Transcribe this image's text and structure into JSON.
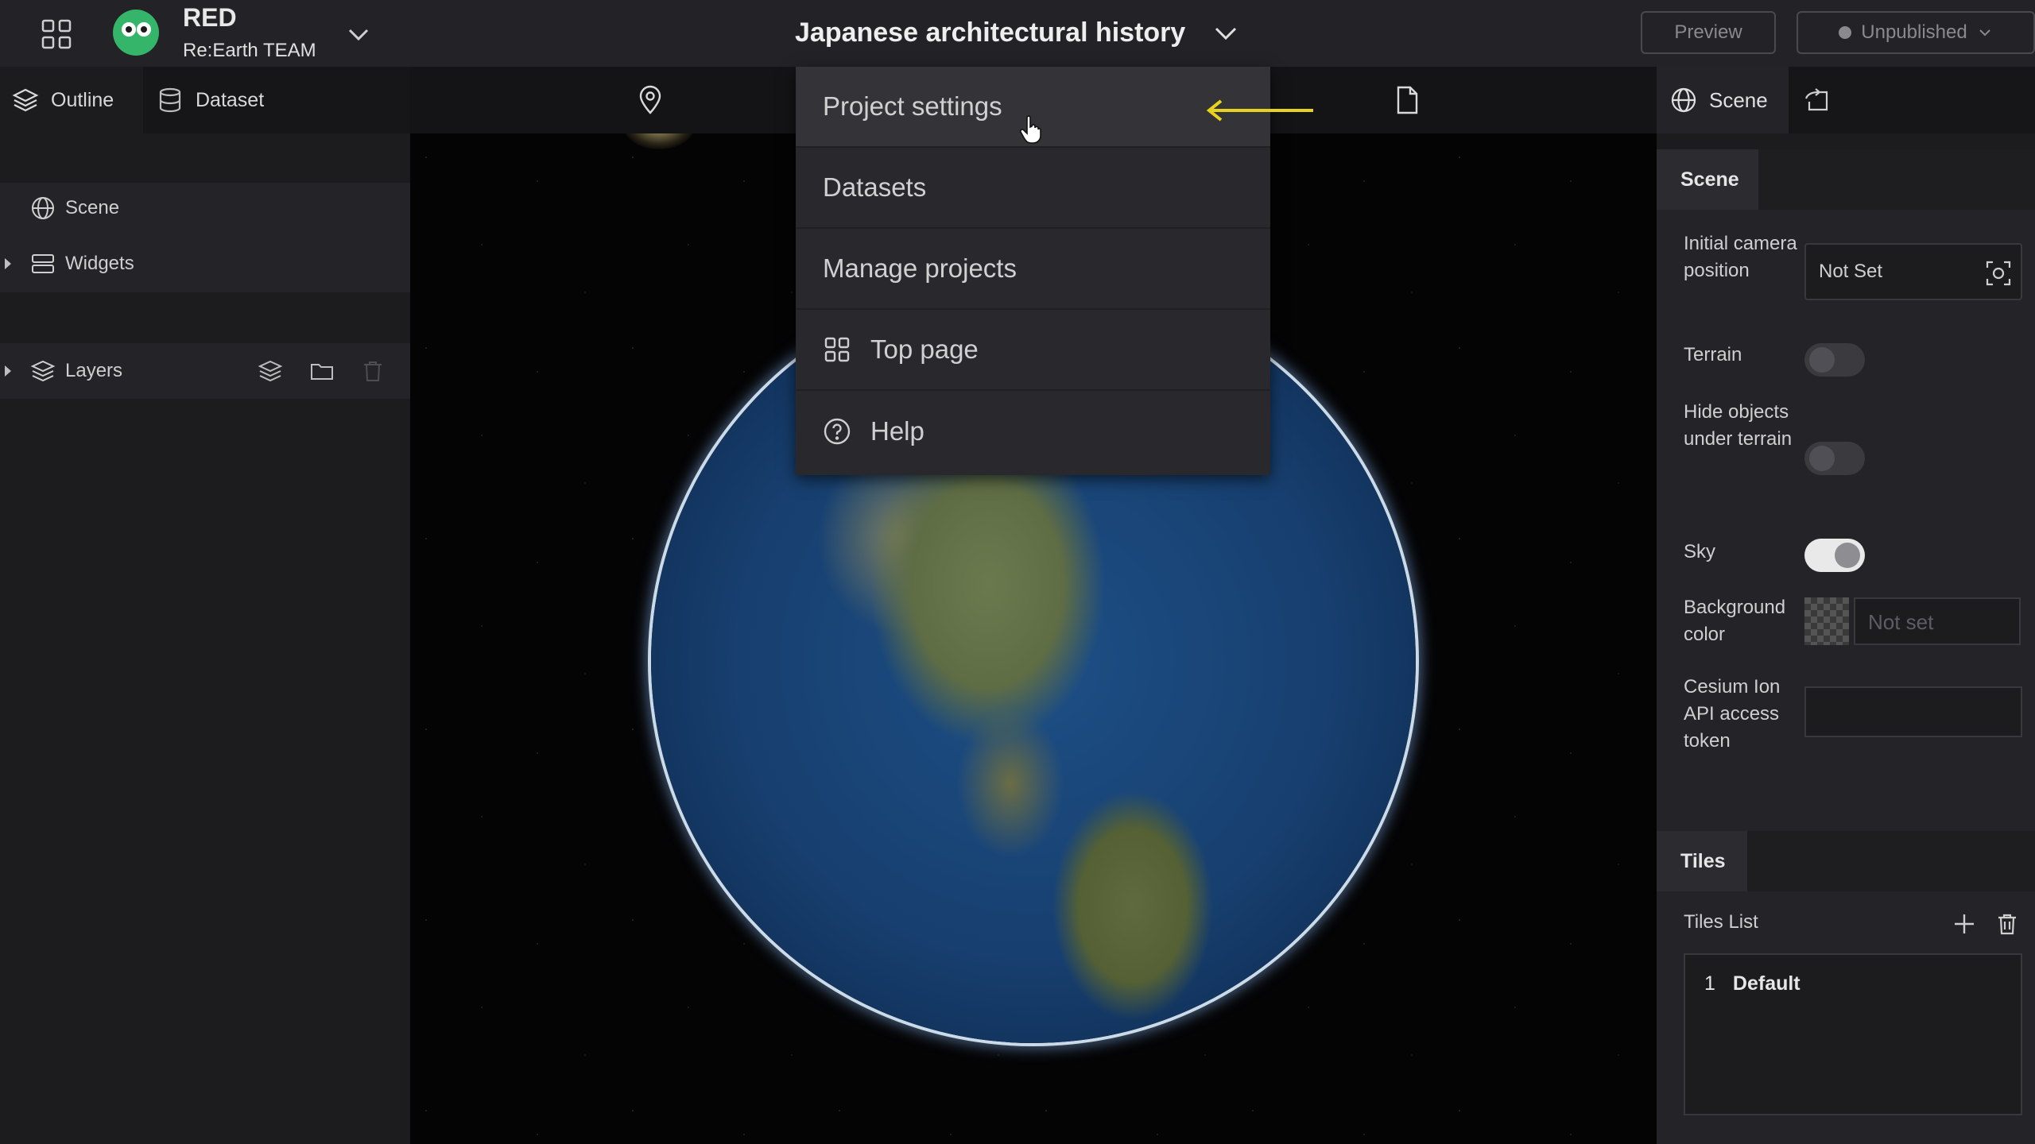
{
  "header": {
    "workspace_name": "RED",
    "workspace_team": "Re:Earth TEAM",
    "project_title": "Japanese architectural history",
    "preview_label": "Preview",
    "publish_status": "Unpublished"
  },
  "left_panel": {
    "tabs": [
      {
        "label": "Outline",
        "icon": "layers-icon",
        "active": true
      },
      {
        "label": "Dataset",
        "icon": "database-icon",
        "active": false
      }
    ],
    "tree": {
      "scene": "Scene",
      "widgets": "Widgets",
      "layers": "Layers"
    }
  },
  "project_menu": {
    "items": [
      {
        "label": "Project settings",
        "hover": true
      },
      {
        "label": "Datasets"
      },
      {
        "label": "Manage projects"
      },
      {
        "label": "Top page",
        "icon": "grid-icon"
      },
      {
        "label": "Help",
        "icon": "help-circle-icon"
      }
    ]
  },
  "right_panel": {
    "tabs": [
      {
        "label": "Scene",
        "icon": "globe-icon",
        "active": true
      },
      {
        "label": "",
        "icon": "export-icon",
        "active": false
      }
    ],
    "scene_group": {
      "title": "Scene",
      "camera_label": "Initial camera position",
      "camera_value": "Not Set",
      "terrain_label": "Terrain",
      "terrain_on": false,
      "hide_label": "Hide objects under terrain",
      "hide_on": false,
      "sky_label": "Sky",
      "sky_on": true,
      "bg_label": "Background color",
      "bg_placeholder": "Not set",
      "token_label": "Cesium Ion API access token",
      "token_value": ""
    },
    "tiles_group": {
      "title": "Tiles",
      "list_label": "Tiles List",
      "tiles": [
        {
          "index": "1",
          "name": "Default"
        }
      ]
    }
  },
  "colors": {
    "header_bg": "#232226",
    "panel_bg": "#1c1c1f",
    "menu_bg": "#29292d",
    "avatar": "#35b569",
    "annotation_arrow": "#e7d21f"
  }
}
